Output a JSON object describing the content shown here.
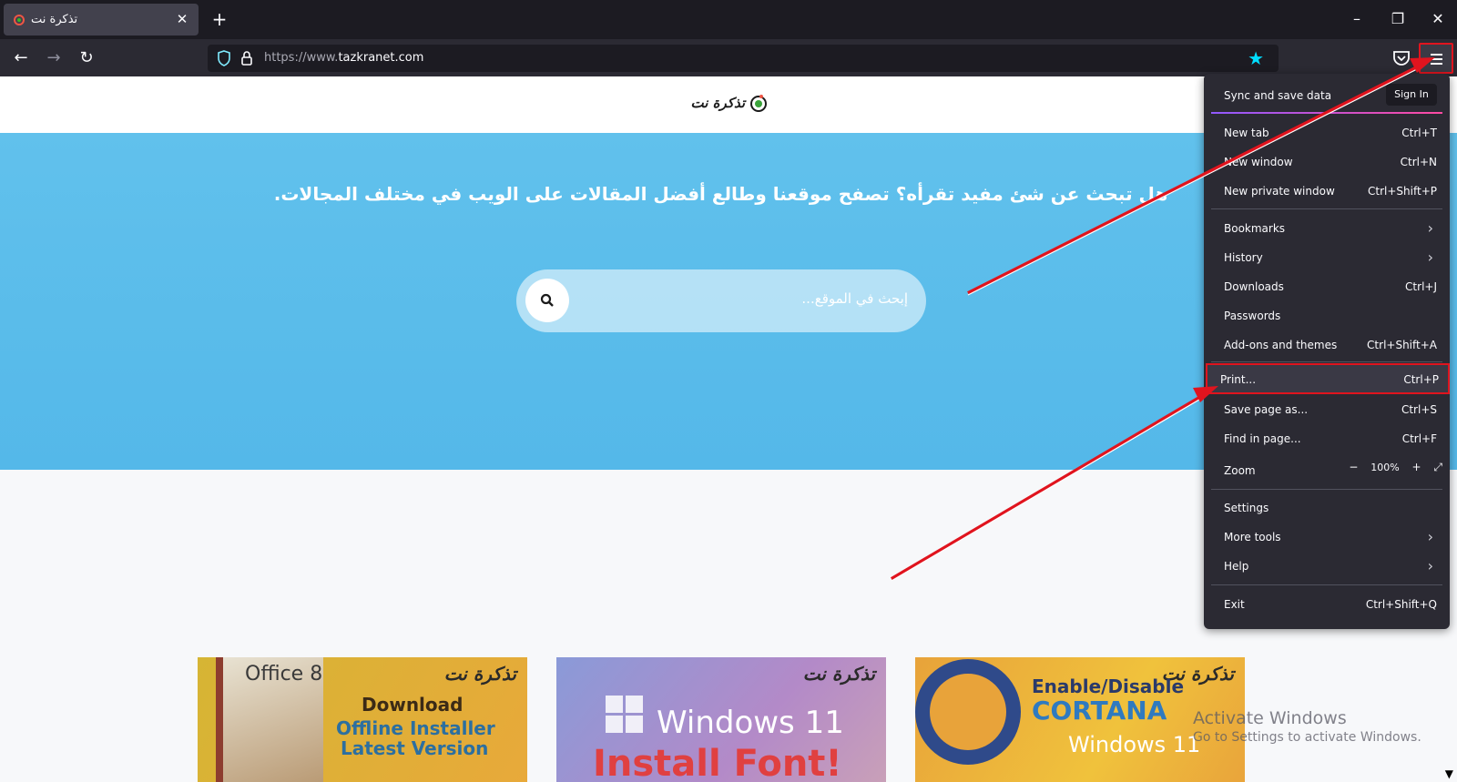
{
  "browser": {
    "tab_title": "تذكرة نت",
    "url_domain": "tazkranet.com",
    "url_prefix": "https://www."
  },
  "page": {
    "logo_text": "تذكرة نت",
    "hero_text": "هل تبحث عن شئ مفيد تقرأه؟ تصفح موقعنا وطالع أفضل المقالات على الويب في مختلف المجالات.",
    "search_placeholder": "إبحث في الموقع..."
  },
  "cards": [
    {
      "brand": "تذكرة نت",
      "lines": [
        "Office 8",
        "Download",
        "Offline Installer",
        "Latest Version"
      ]
    },
    {
      "brand": "تذكرة نت",
      "lines": [
        "Windows 11",
        "Install Font!"
      ]
    },
    {
      "brand": "تذكرة نت",
      "lines": [
        "Enable/Disable",
        "CORTANA",
        "Windows 11"
      ]
    }
  ],
  "watermark": {
    "line1": "Activate Windows",
    "line2": "Go to Settings to activate Windows."
  },
  "menu": {
    "sync_label": "Sync and save data",
    "sign_in": "Sign In",
    "items": [
      {
        "label": "New tab",
        "shortcut": "Ctrl+T"
      },
      {
        "label": "New window",
        "shortcut": "Ctrl+N"
      },
      {
        "label": "New private window",
        "shortcut": "Ctrl+Shift+P"
      },
      {
        "label": "Bookmarks",
        "shortcut": ""
      },
      {
        "label": "History",
        "shortcut": ""
      },
      {
        "label": "Downloads",
        "shortcut": "Ctrl+J"
      },
      {
        "label": "Passwords",
        "shortcut": ""
      },
      {
        "label": "Add-ons and themes",
        "shortcut": "Ctrl+Shift+A"
      },
      {
        "label": "Print...",
        "shortcut": "Ctrl+P"
      },
      {
        "label": "Save page as...",
        "shortcut": "Ctrl+S"
      },
      {
        "label": "Find in page...",
        "shortcut": "Ctrl+F"
      },
      {
        "label": "Zoom",
        "shortcut": ""
      },
      {
        "label": "Settings",
        "shortcut": ""
      },
      {
        "label": "More tools",
        "shortcut": ""
      },
      {
        "label": "Help",
        "shortcut": ""
      },
      {
        "label": "Exit",
        "shortcut": "Ctrl+Shift+Q"
      }
    ],
    "zoom_minus": "−",
    "zoom_value": "100%",
    "zoom_plus": "+"
  },
  "colors": {
    "accent_highlight": "#e0141e",
    "hero_blue": "#5bbdeb",
    "star_blue": "#00ddff"
  }
}
